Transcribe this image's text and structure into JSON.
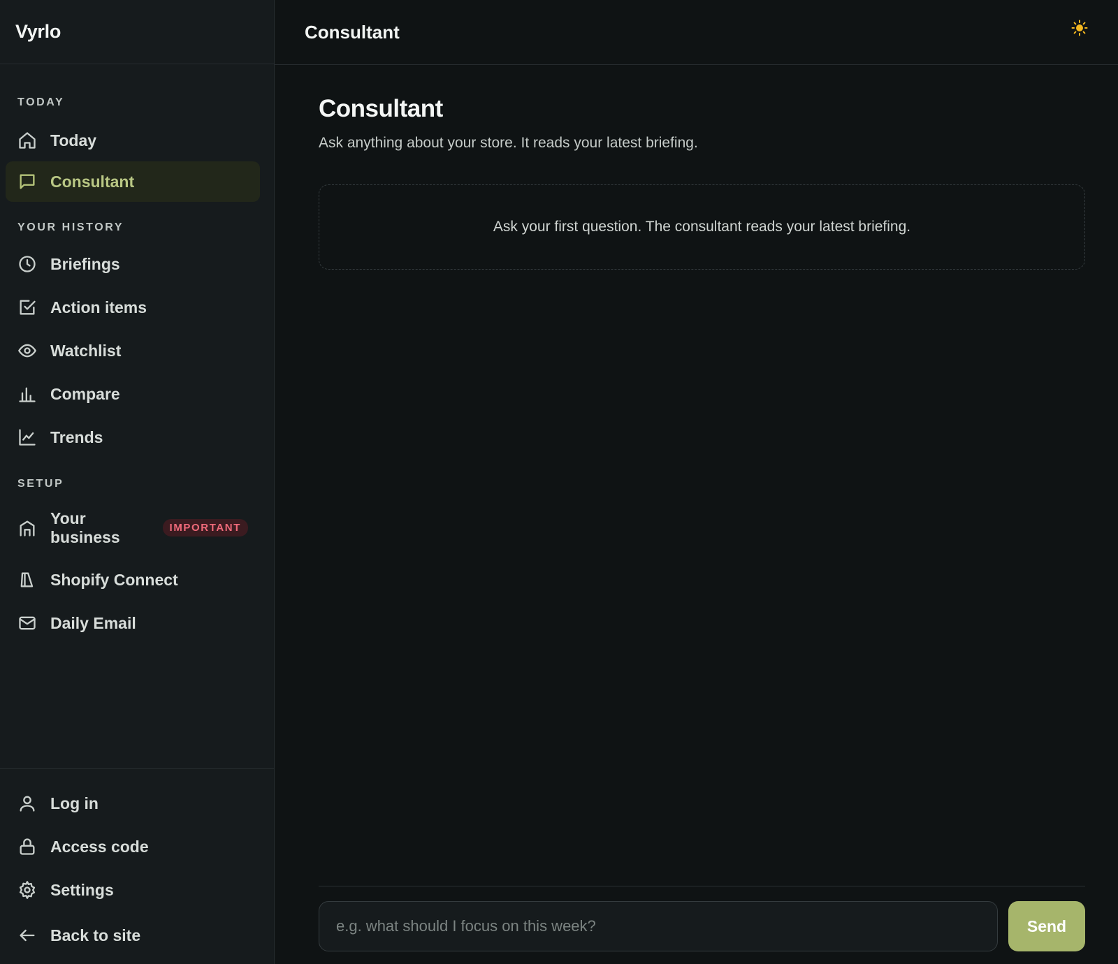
{
  "app": {
    "brand": "Vyrlo"
  },
  "header": {
    "title": "Consultant",
    "theme_icon": "sun-icon",
    "accent": "#a6b56b"
  },
  "sidebar": {
    "sections": {
      "today": "TODAY",
      "history": "YOUR HISTORY",
      "setup": "SETUP"
    },
    "items": {
      "today": {
        "label": "Today",
        "icon": "home-icon"
      },
      "consultant": {
        "label": "Consultant",
        "icon": "message-square-icon",
        "active": true
      },
      "briefings": {
        "label": "Briefings",
        "icon": "clock-icon"
      },
      "action_items": {
        "label": "Action items",
        "icon": "check-square-icon"
      },
      "watchlist": {
        "label": "Watchlist",
        "icon": "eye-icon"
      },
      "compare": {
        "label": "Compare",
        "icon": "bar-chart-icon"
      },
      "trends": {
        "label": "Trends",
        "icon": "line-chart-icon"
      },
      "your_business": {
        "label": "Your business",
        "icon": "store-icon",
        "badge": "IMPORTANT"
      },
      "shopify_connect": {
        "label": "Shopify Connect",
        "icon": "shopping-bag-icon"
      },
      "daily_email": {
        "label": "Daily Email",
        "icon": "mail-icon"
      }
    },
    "footer": {
      "login": {
        "label": "Log in",
        "icon": "user-icon"
      },
      "access_code": {
        "label": "Access code",
        "icon": "lock-icon"
      },
      "settings": {
        "label": "Settings",
        "icon": "gear-icon"
      },
      "back": {
        "label": "Back to site",
        "icon": "arrow-left-icon"
      }
    }
  },
  "main": {
    "title": "Consultant",
    "subtitle": "Ask anything about your store. It reads your latest briefing.",
    "empty_state": "Ask your first question. The consultant reads your latest briefing.",
    "composer": {
      "placeholder": "e.g. what should I focus on this week?",
      "value": "",
      "send_label": "Send"
    }
  }
}
